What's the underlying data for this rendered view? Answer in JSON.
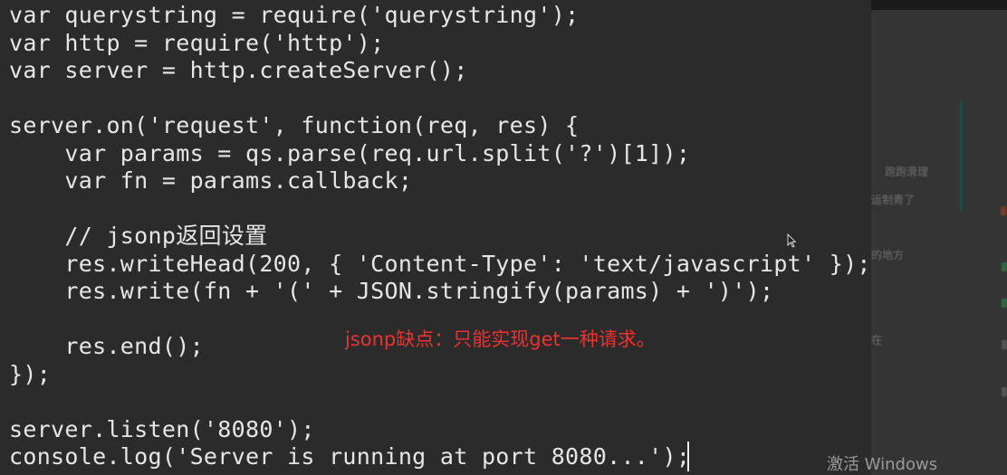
{
  "editor": {
    "lines": [
      "var querystring = require('querystring');",
      "var http = require('http');",
      "var server = http.createServer();",
      "",
      "server.on('request', function(req, res) {",
      "    var params = qs.parse(req.url.split('?')[1]);",
      "    var fn = params.callback;",
      "",
      "    // jsonp返回设置",
      "    res.writeHead(200, { 'Content-Type': 'text/javascript' });",
      "    res.write(fn + '(' + JSON.stringify(params) + ')');",
      "",
      "    res.end();",
      "});",
      "",
      "server.listen('8080');",
      "console.log('Server is running at port 8080...');"
    ]
  },
  "annotation": "jsonp缺点：只能实现get一种请求。",
  "watermark": "激活 Windows",
  "background_window": {
    "fragment_1": "跑跑滑理",
    "fragment_2": "运制青了",
    "fragment_3": "的地方",
    "fragment_4": "在"
  },
  "colors": {
    "editor_background": "#2b2b2b",
    "code_text": "#e6e6e6",
    "annotation_text": "#e8332f",
    "watermark_text": "#9a9a9a",
    "background_window": "#343434",
    "background_divider": "#1f4a44"
  },
  "icons": {
    "mouse_cursor": "arrow-pointer-icon",
    "text_caret": "text-caret"
  }
}
